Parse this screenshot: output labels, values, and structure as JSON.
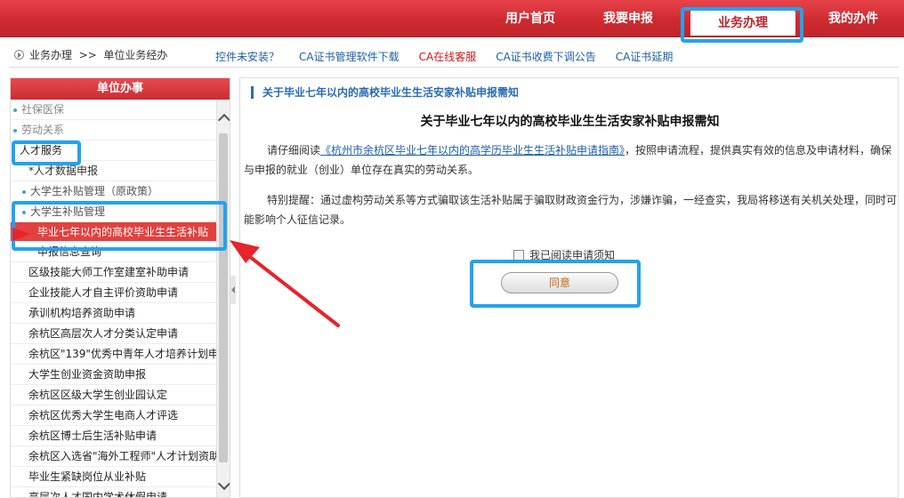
{
  "topnav": {
    "items": [
      {
        "label": "用户首页"
      },
      {
        "label": "我要申报"
      },
      {
        "label": "业务办理"
      },
      {
        "label": "我的办件"
      }
    ]
  },
  "breadcrumb": {
    "path": "业务办理  >>  单位业务经办"
  },
  "toplinks": [
    {
      "label": "控件未安装？"
    },
    {
      "label": "CA证书管理软件下载"
    },
    {
      "label": "CA在线客服"
    },
    {
      "label": "CA证书收费下调公告"
    },
    {
      "label": "CA证书延期"
    }
  ],
  "sidebar": {
    "title": "单位办事",
    "items": [
      {
        "label": "社保医保"
      },
      {
        "label": "劳动关系"
      },
      {
        "label": "人才服务"
      },
      {
        "label": "*人才数据申报"
      },
      {
        "label": "大学生补贴管理（原政策）"
      },
      {
        "label": "大学生补贴管理"
      },
      {
        "label": "毕业七年以内的高校毕业生生活补贴"
      },
      {
        "label": "申报信息查询"
      },
      {
        "label": "区级技能大师工作室建室补助申请"
      },
      {
        "label": "企业技能人才自主评价资助申请"
      },
      {
        "label": "承训机构培养资助申请"
      },
      {
        "label": "余杭区高层次人才分类认定申请"
      },
      {
        "label": "余杭区\"139\"优秀中青年人才培养计划申"
      },
      {
        "label": "大学生创业资金资助申报"
      },
      {
        "label": "余杭区区级大学生创业园认定"
      },
      {
        "label": "余杭区优秀大学生电商人才评选"
      },
      {
        "label": "余杭区博士后生活补贴申请"
      },
      {
        "label": "余杭区入选省\"海外工程师\"人才计划资助"
      },
      {
        "label": "毕业生紧缺岗位从业补贴"
      },
      {
        "label": "高层次人才国内学术休假申请"
      }
    ]
  },
  "main": {
    "header": "关于毕业七年以内的高校毕业生生活安家补贴申报需知",
    "title": "关于毕业七年以内的高校毕业生生活安家补贴申报需知",
    "para1_prefix": "请仔细阅读",
    "para1_link": "《杭州市余杭区毕业七年以内的高学历毕业生生活补贴申请指南》",
    "para1_suffix": "，按照申请流程，提供真实有效的信息及申请材料，确保与申报的就业（创业）单位存在真实的劳动关系。",
    "para2": "特别提醒：通过虚构劳动关系等方式骗取该生活补贴属于骗取财政资金行为，涉嫌诈骗，一经查实，我局将移送有关机关处理，同时可能影响个人征信记录。",
    "agree_label": "我已阅读申请须知",
    "agree_button": "同意"
  },
  "colors": {
    "brand_red": "#cf2a31",
    "link_blue": "#1f5fa8",
    "highlight_blue": "#22a3ee",
    "annotation_red": "#e8232a"
  }
}
